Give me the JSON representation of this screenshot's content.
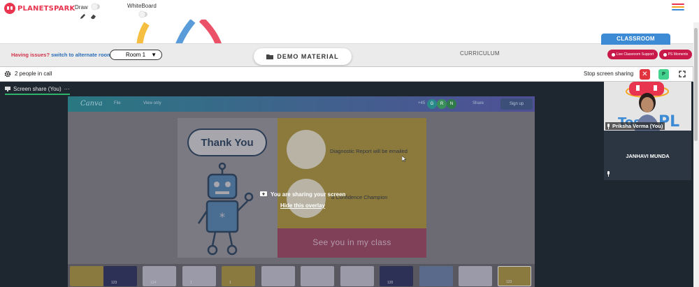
{
  "app": {
    "logo_text": "PLANETSPARK"
  },
  "toolbar": {
    "draw_label": "Draw",
    "whiteboard_label": "WhiteBoard"
  },
  "controls": {
    "issue_text": "Having issues?",
    "issue_link": "switch to alternate room",
    "room": "Room 1",
    "demo_material": "DEMO MATERIAL",
    "curriculum": "CURRICULUM",
    "classroom_tab": "CLASSROOM",
    "live_support": "Live Classroom Support",
    "ps_moments": "PS Moments"
  },
  "call": {
    "people_count": "2 people in call",
    "stop_sharing": "Stop screen sharing",
    "stop_icon": "✕",
    "p_button": "P",
    "share_tab": "Screen share (You)",
    "share_tab_more": "···"
  },
  "shared_screen": {
    "canva_logo": "Canva",
    "file_menu": "File",
    "view_only": "View only",
    "collab_count": "+45",
    "avatars": [
      "G",
      "R",
      "N"
    ],
    "share": "Share",
    "sign_up": "Sign up",
    "slide": {
      "thank_you": "Thank You",
      "diagnostic": "Diagnostic Report will be emailed",
      "champion": "a Confidence Champion",
      "see_you": "See you in my class"
    },
    "overlay_message": "You are sharing your screen",
    "hide_overlay": "Hide this overlay",
    "thumbnails": [
      "123",
      "124",
      "1",
      "1",
      "120",
      "123"
    ]
  },
  "participants": [
    {
      "name": "Priksha Verma (You)"
    },
    {
      "name": "JANHAVI MUNDA"
    }
  ],
  "colors": {
    "brand": "#e8344e",
    "accent_blue": "#3d8bd4",
    "danger": "#e1343f",
    "success": "#45d18e"
  }
}
